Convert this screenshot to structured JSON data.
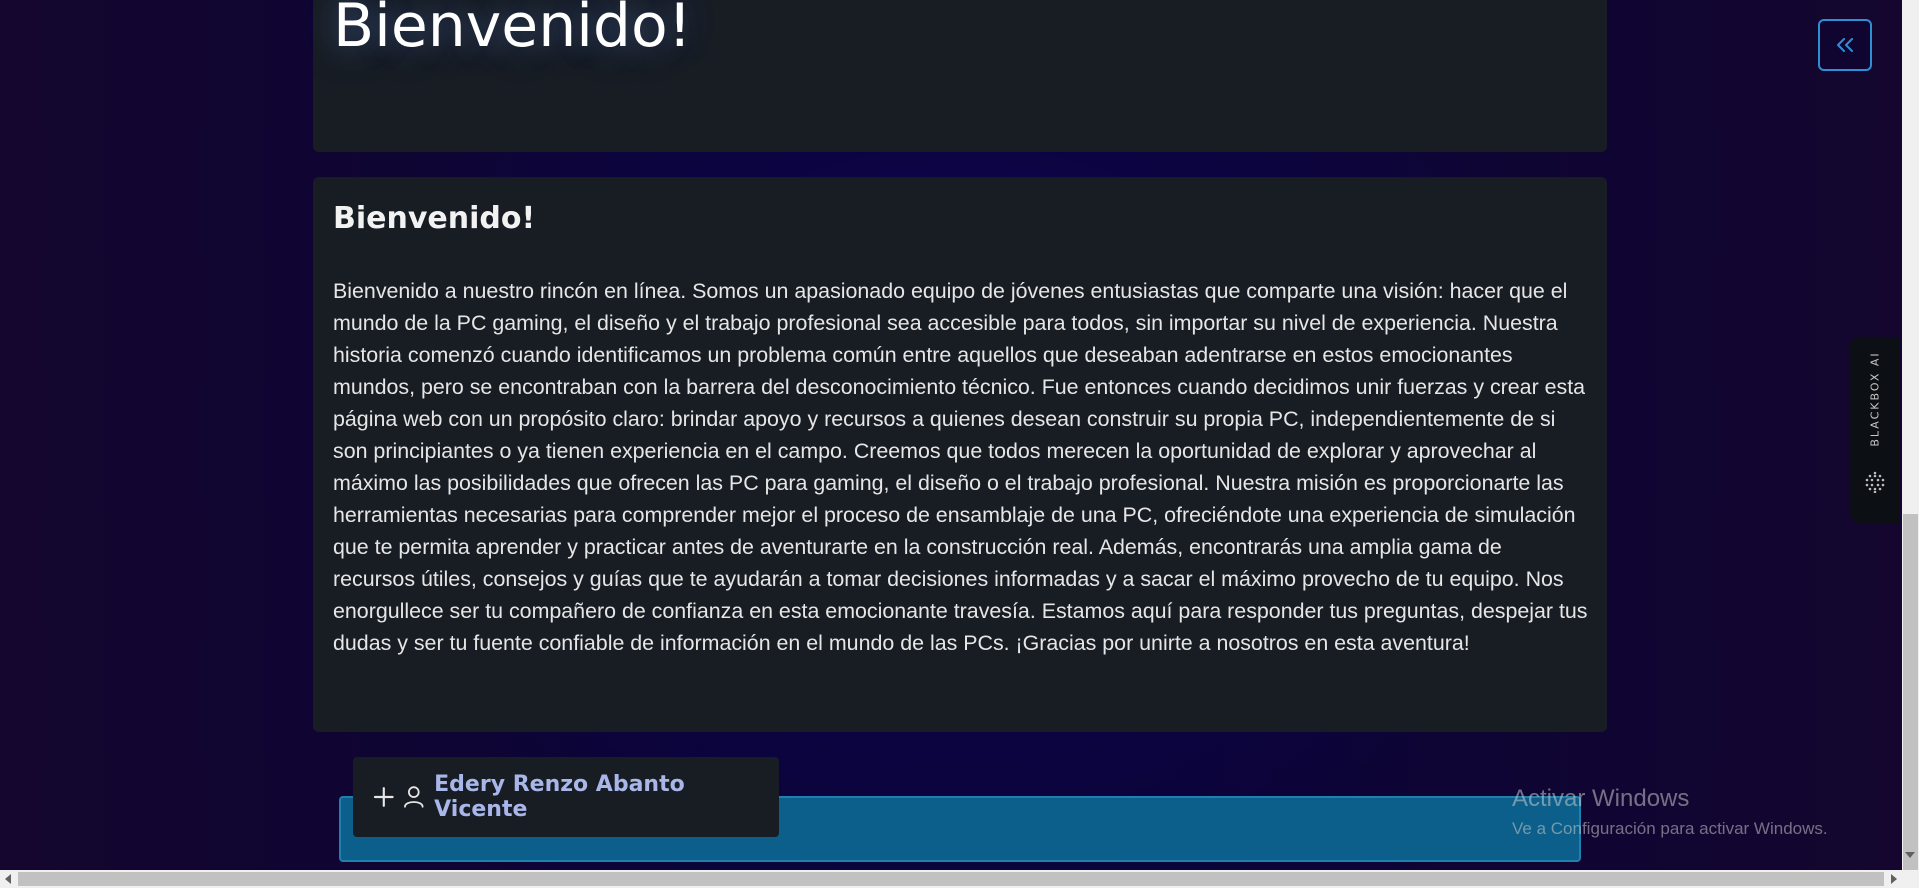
{
  "hero": {
    "title": "Bienvenido!"
  },
  "about": {
    "title": "Bienvenido!",
    "text": "Bienvenido a nuestro rincón en línea. Somos un apasionado equipo de jóvenes entusiastas que comparte una visión: hacer que el mundo de la PC gaming, el diseño y el trabajo profesional sea accesible para todos, sin importar su nivel de experiencia. Nuestra historia comenzó cuando identificamos un problema común entre aquellos que deseaban adentrarse en estos emocionantes mundos, pero se encontraban con la barrera del desconocimiento técnico. Fue entonces cuando decidimos unir fuerzas y crear esta página web con un propósito claro: brindar apoyo y recursos a quienes desean construir su propia PC, independientemente de si son principiantes o ya tienen experiencia en el campo. Creemos que todos merecen la oportunidad de explorar y aprovechar al máximo las posibilidades que ofrecen las PC para gaming, el diseño o el trabajo profesional. Nuestra misión es proporcionarte las herramientas necesarias para comprender mejor el proceso de ensamblaje de una PC, ofreciéndote una experiencia de simulación que te permita aprender y practicar antes de aventurarte en la construcción real. Además, encontrarás una amplia gama de recursos útiles, consejos y guías que te ayudarán a tomar decisiones informadas y a sacar el máximo provecho de tu equipo. Nos enorgullece ser tu compañero de confianza en esta emocionante travesía. Estamos aquí para responder tus preguntas, despejar tus dudas y ser tu fuente confiable de información en el mundo de las PCs. ¡Gracias por unirte a nosotros en esta aventura!"
  },
  "team": {
    "member_name": "Edery Renzo Abanto Vicente"
  },
  "blackbox": {
    "label": "BLACKBOX AI"
  },
  "windows": {
    "activate_title": "Activar Windows",
    "activate_subtitle": "Ve a Configuración para activar Windows."
  },
  "icons": {
    "collapse": "chevrons-left-icon",
    "expand": "plus-icon",
    "user": "user-icon",
    "blackbox_logo": "dot-grid-icon"
  },
  "colors": {
    "accent_blue": "#2f8fd6",
    "card_bg": "#181d24",
    "bar_blue": "#0b5f8a",
    "name_color": "#a9b6ea"
  }
}
